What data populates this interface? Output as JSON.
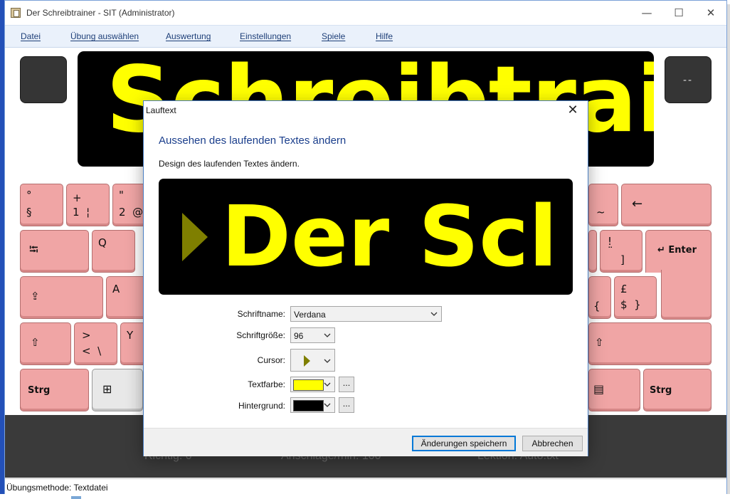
{
  "window": {
    "title": "Der Schreibtrainer - SIT (Administrator)",
    "minimize": "—",
    "maximize": "☐",
    "close": "✕"
  },
  "menu": [
    "Datei",
    "Übung auswählen",
    "Auswertung",
    "Einstellungen",
    "Spiele",
    "Hilfe"
  ],
  "marquee": {
    "text": "Schreibtrai",
    "color": "#ffff00",
    "background": "#000000"
  },
  "side_right": "--",
  "keyboard": {
    "row1": {
      "k1_top": "°",
      "k1_bottom": "§",
      "k2_top": "+",
      "k2_bottom": "1  ¦",
      "k3_top": "\"",
      "k3_bottom": "2  @",
      "k_right_small": "~",
      "backspace": "←"
    },
    "row2": {
      "tab": "⭾",
      "q": "Q",
      "k_exc_top": "!",
      "k_exc_mid": "¨",
      "k_exc_bottom": "]",
      "enter": "↵ Enter"
    },
    "row3": {
      "caps": "⇪",
      "a": "A",
      "k_brace_left": "{",
      "k_pound_top": "£",
      "k_pound_bottom": "$  }"
    },
    "row4": {
      "shift_left": "⇧",
      "lt_top": ">",
      "lt_bottom": "<  \\",
      "y": "Y",
      "shift_right": "⇧"
    },
    "row5": {
      "ctrl_left": "Strg",
      "win": "⊞",
      "menu": "▤",
      "ctrl_right": "Strg"
    }
  },
  "stats": {
    "richtig": "Richtig: 0",
    "anschlaege": "Anschläge/min: 100",
    "lektion": "Lektion: Auto.txt"
  },
  "status": "Übungsmethode: Textdatei",
  "dialog": {
    "title": "Lauftext",
    "heading": "Aussehen des laufenden Textes ändern",
    "description": "Design des laufenden Textes ändern.",
    "preview_text": "Der Scl",
    "fields": {
      "font_name_label": "Schriftname:",
      "font_name_value": "Verdana",
      "font_size_label": "Schriftgröße:",
      "font_size_value": "96",
      "cursor_label": "Cursor:",
      "text_color_label": "Textfarbe:",
      "text_color_value": "#ffff00",
      "background_label": "Hintergrund:",
      "background_value": "#000000",
      "more_button": "..."
    },
    "save_button": "Änderungen speichern",
    "cancel_button": "Abbrechen"
  }
}
